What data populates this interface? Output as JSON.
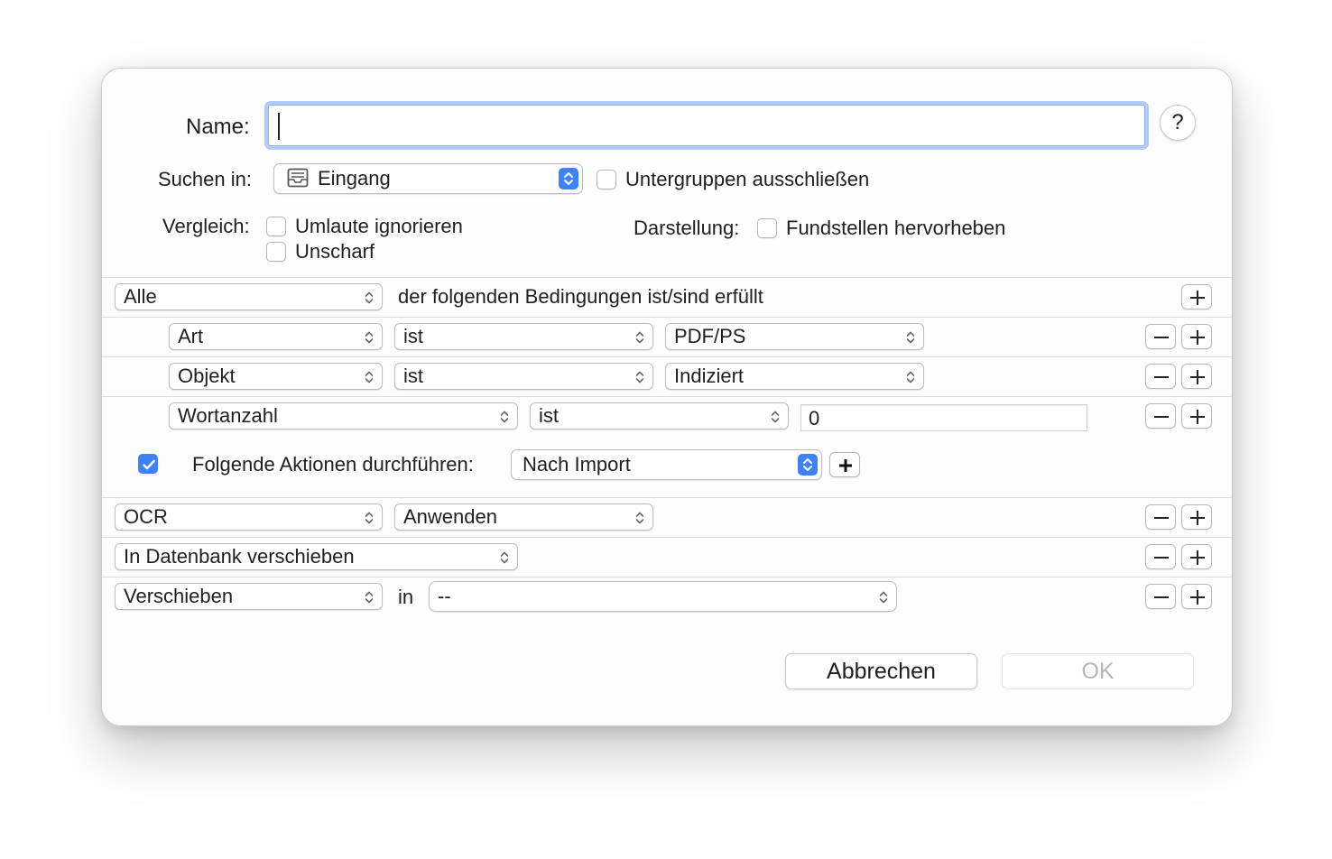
{
  "header": {
    "name_label": "Name:",
    "name_value": "",
    "help_label": "?"
  },
  "search_in": {
    "label": "Suchen in:",
    "value": "Eingang",
    "icon": "inbox-icon",
    "exclude_subgroups_label": "Untergruppen ausschließen",
    "exclude_subgroups_checked": false
  },
  "comparison": {
    "label": "Vergleich:",
    "ignore_umlauts_label": "Umlaute ignorieren",
    "ignore_umlauts_checked": false,
    "fuzzy_label": "Unscharf",
    "fuzzy_checked": false
  },
  "display": {
    "label": "Darstellung:",
    "highlight_label": "Fundstellen hervorheben",
    "highlight_checked": false
  },
  "conditions": {
    "match_value": "Alle",
    "match_text": "der folgenden Bedingungen ist/sind erfüllt",
    "rows": [
      {
        "field": "Art",
        "operator": "ist",
        "value": "PDF/PS"
      },
      {
        "field": "Objekt",
        "operator": "ist",
        "value": "Indiziert"
      },
      {
        "field": "Wortanzahl",
        "operator": "ist",
        "value": "0"
      }
    ]
  },
  "actions": {
    "enabled": true,
    "label": "Folgende Aktionen durchführen:",
    "trigger": "Nach Import",
    "rows": [
      {
        "action": "OCR",
        "option": "Anwenden"
      },
      {
        "action": "In Datenbank verschieben"
      },
      {
        "action": "Verschieben",
        "connector": "in",
        "target": "--"
      }
    ]
  },
  "buttons": {
    "cancel": "Abbrechen",
    "ok": "OK"
  },
  "colors": {
    "accent": "#3e82f7",
    "focus_ring": "#78a4ee"
  },
  "plus_symbol": "+",
  "minus_symbol": "−"
}
